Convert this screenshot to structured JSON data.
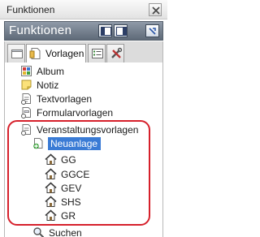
{
  "window": {
    "title": "Funktionen"
  },
  "header": {
    "title": "Funktionen"
  },
  "tabs": [
    {
      "label": "",
      "icon": "blank-page-icon"
    },
    {
      "label": "Vorlagen",
      "icon": "template-page-icon"
    },
    {
      "label": "",
      "icon": "list-icon"
    },
    {
      "label": "",
      "icon": "tools-icon"
    }
  ],
  "tree": {
    "items": [
      {
        "label": "Album",
        "icon": "album-icon"
      },
      {
        "label": "Notiz",
        "icon": "note-icon"
      },
      {
        "label": "Textvorlagen",
        "icon": "text-template-icon"
      },
      {
        "label": "Formularvorlagen",
        "icon": "form-template-icon"
      },
      {
        "label": "Veranstaltungsvorlagen",
        "icon": "event-template-icon"
      },
      {
        "label": "Neuanlage",
        "icon": "new-document-icon"
      },
      {
        "label": "GG",
        "icon": "house-icon"
      },
      {
        "label": "GGCE",
        "icon": "house-icon"
      },
      {
        "label": "GEV",
        "icon": "house-icon"
      },
      {
        "label": "SHS",
        "icon": "house-icon"
      },
      {
        "label": "GR",
        "icon": "house-icon"
      },
      {
        "label": "Suchen",
        "icon": "search-icon"
      }
    ]
  },
  "colors": {
    "header": "#6f7a88",
    "selection": "#3a7bd5",
    "annotation": "#d6202b"
  }
}
